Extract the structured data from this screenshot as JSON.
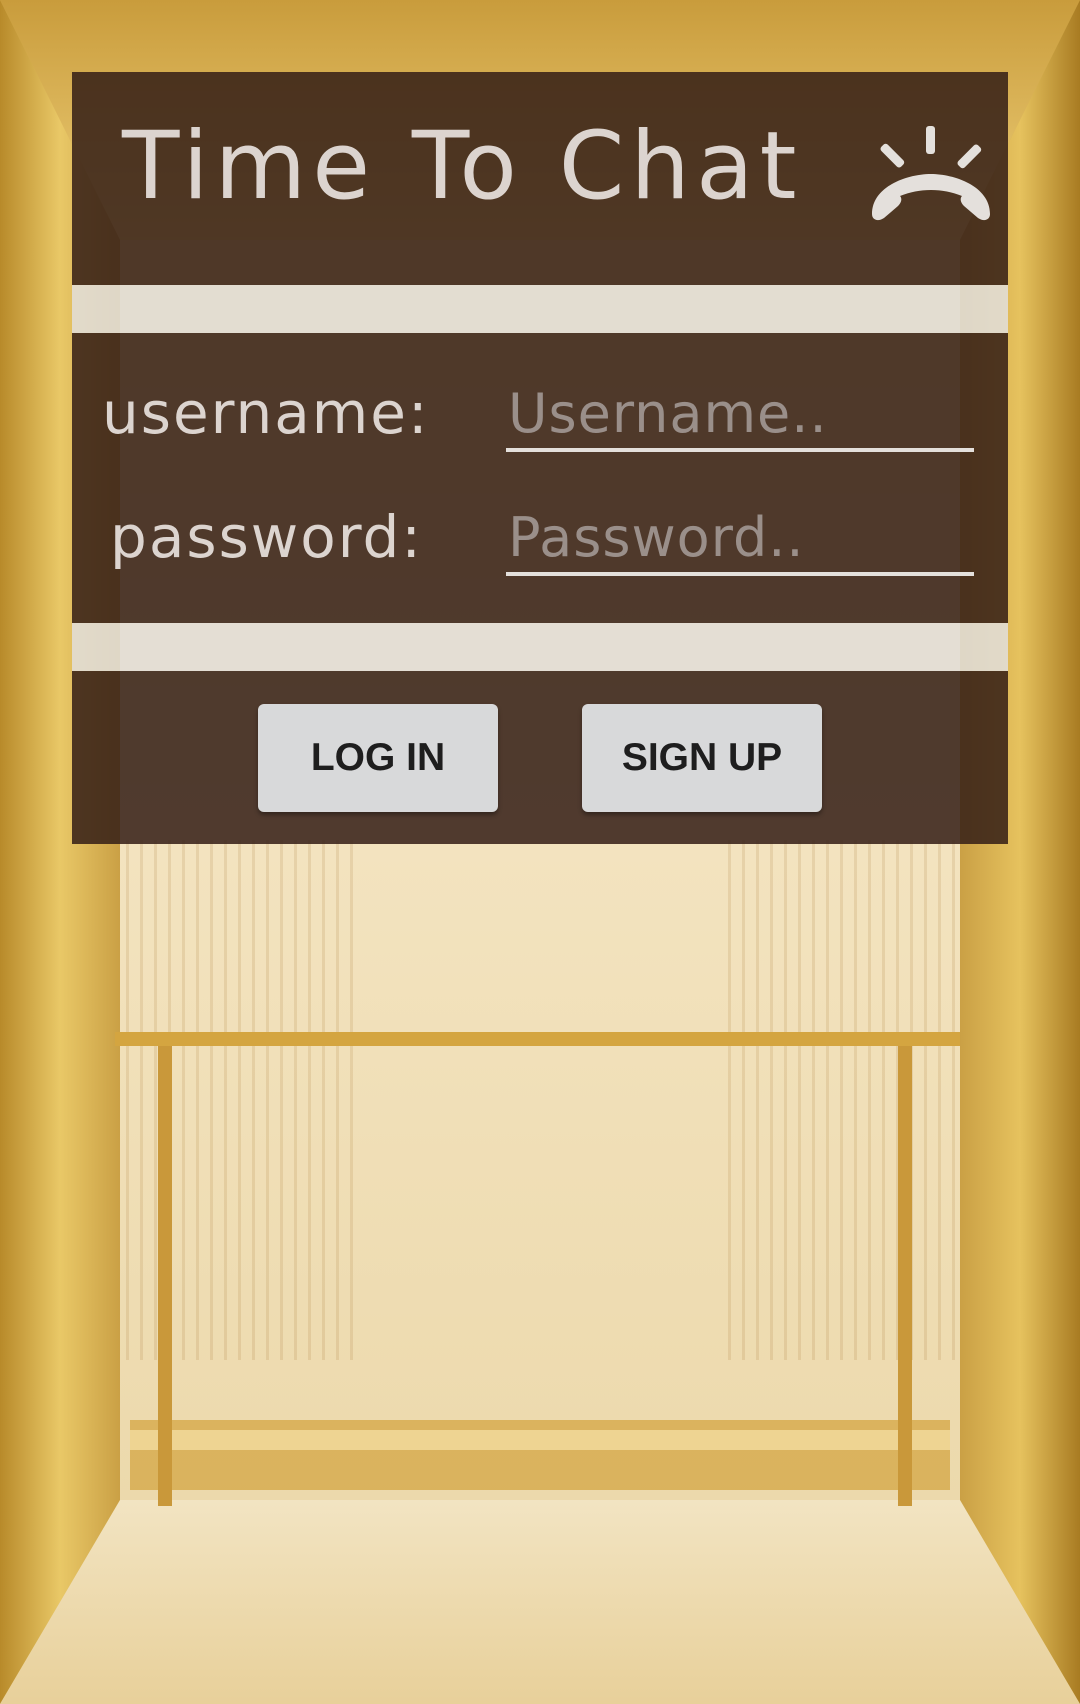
{
  "header": {
    "title": "Time To Chat",
    "icon": "phone-hangup-icon"
  },
  "form": {
    "username": {
      "label": "username:",
      "placeholder": "Username..",
      "value": ""
    },
    "password": {
      "label": "password:",
      "placeholder": "Password..",
      "value": ""
    }
  },
  "actions": {
    "login_label": "LOG IN",
    "signup_label": "SIGN UP"
  },
  "background": {
    "description_icon": "elevator-background-image"
  },
  "colors": {
    "panel": "#341e16",
    "divider": "#e1ded8",
    "text": "#dcd4cf",
    "button": "#d8d9da",
    "button_text": "#1e1e1e",
    "gold": "#d9b050"
  }
}
